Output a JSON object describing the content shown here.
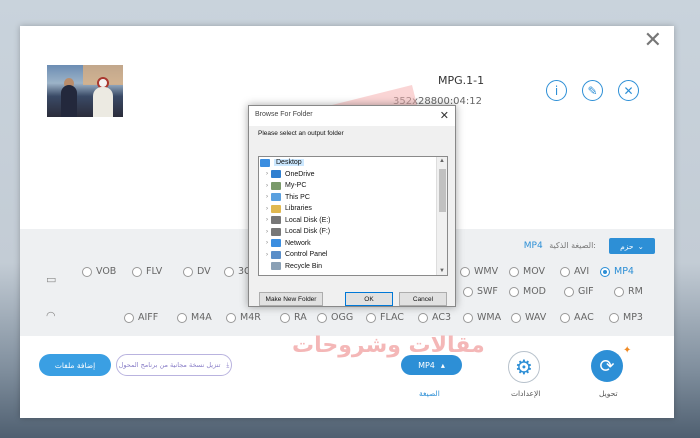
{
  "window": {
    "close_symbol": "✕"
  },
  "file": {
    "name": "MPG.1-1",
    "meta": "352x28800:04:12",
    "actions": [
      {
        "icon": "info-icon",
        "symbol": "i"
      },
      {
        "icon": "edit-icon",
        "symbol": "✎"
      },
      {
        "icon": "remove-icon",
        "symbol": "✕"
      }
    ]
  },
  "selection": {
    "label": "الصيغة الذكية:",
    "value": "MP4",
    "pack_label": "حزم"
  },
  "video_formats": [
    "VOB",
    "FLV",
    "DV",
    "3GP",
    "WMV",
    "MOV",
    "AVI",
    "MP4",
    "SWF",
    "MOD",
    "GIF",
    "RM"
  ],
  "video_selected": "MP4",
  "audio_formats": [
    "AIFF",
    "M4A",
    "M4R",
    "RA",
    "OGG",
    "FLAC",
    "AC3",
    "WMA",
    "WAV",
    "AAC",
    "MP3"
  ],
  "bottom": {
    "add_files": "إضافة ملفات",
    "download": "تنزيل نسخة مجانية من برنامج المحول",
    "format_button": "MP4",
    "format_caption": "الصيغة",
    "settings_caption": "الإعدادات",
    "convert_caption": "تحويل"
  },
  "watermark": {
    "text": "مقالات وشروحات"
  },
  "dialog": {
    "title": "Browse For Folder",
    "prompt": "Please select an output folder",
    "tree": [
      {
        "label": "Desktop",
        "icon": "desktop-icon",
        "color": "#3b8ee0",
        "level": 0,
        "selected": true,
        "arrow": ""
      },
      {
        "label": "OneDrive",
        "icon": "cloud-icon",
        "color": "#2f7fd0",
        "level": 1,
        "selected": false,
        "arrow": "›"
      },
      {
        "label": "My-PC",
        "icon": "user-icon",
        "color": "#7a9a6a",
        "level": 1,
        "selected": false,
        "arrow": "›"
      },
      {
        "label": "This PC",
        "icon": "computer-icon",
        "color": "#5aa0df",
        "level": 1,
        "selected": false,
        "arrow": "›"
      },
      {
        "label": "Libraries",
        "icon": "folder-icon",
        "color": "#e0b850",
        "level": 1,
        "selected": false,
        "arrow": "›"
      },
      {
        "label": "Local Disk (E:)",
        "icon": "drive-icon",
        "color": "#777777",
        "level": 1,
        "selected": false,
        "arrow": "›"
      },
      {
        "label": "Local Disk (F:)",
        "icon": "drive-icon",
        "color": "#777777",
        "level": 1,
        "selected": false,
        "arrow": "›"
      },
      {
        "label": "Network",
        "icon": "network-icon",
        "color": "#3b8ee0",
        "level": 1,
        "selected": false,
        "arrow": "›"
      },
      {
        "label": "Control Panel",
        "icon": "control-panel-icon",
        "color": "#5a8ec8",
        "level": 1,
        "selected": false,
        "arrow": "›"
      },
      {
        "label": "Recycle Bin",
        "icon": "recycle-bin-icon",
        "color": "#8aa0b5",
        "level": 1,
        "selected": false,
        "arrow": ""
      }
    ],
    "buttons": {
      "make_folder": "Make New Folder",
      "ok": "OK",
      "cancel": "Cancel"
    }
  }
}
